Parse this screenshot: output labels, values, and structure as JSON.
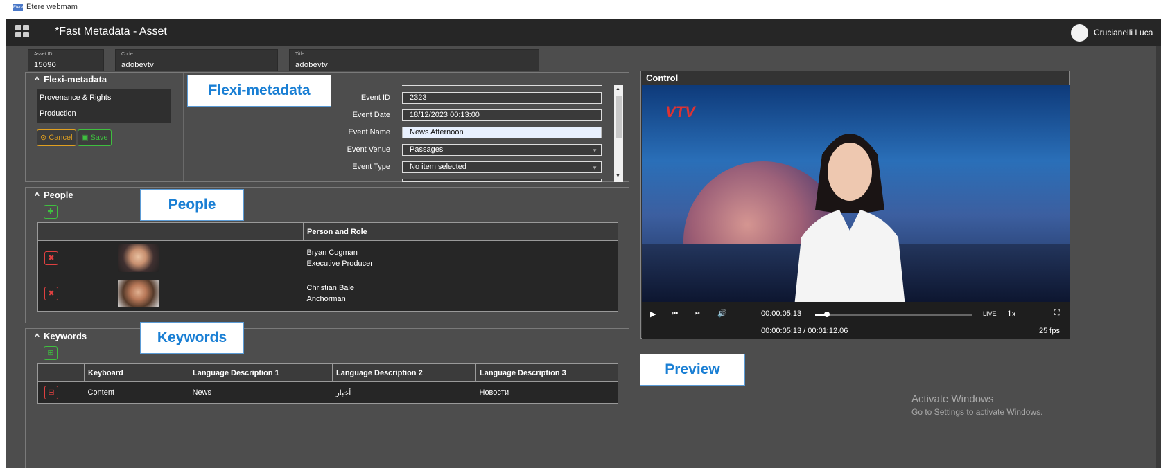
{
  "browser": {
    "title": "Etere webmam",
    "icon": "etere-logo-icon"
  },
  "header": {
    "title": "*Fast Metadata - Asset",
    "user": "Crucianelli Luca"
  },
  "asset_fields": [
    {
      "label": "Asset ID",
      "value": "15090"
    },
    {
      "label": "Code",
      "value": "adobevtv"
    },
    {
      "label": "Title",
      "value": "adobevtv"
    }
  ],
  "flexi": {
    "title": "Flexi-metadata",
    "callout": "Flexi-metadata",
    "list": [
      "Provenance & Rights",
      "Production"
    ],
    "cancel": "Cancel",
    "save": "Save",
    "form": [
      {
        "label": "Event ID",
        "value": "2323"
      },
      {
        "label": "Event Date",
        "value": "18/12/2023 00:13:00"
      },
      {
        "label": "Event Name",
        "value": "News Afternoon"
      },
      {
        "label": "Event Venue",
        "value": "Passages"
      },
      {
        "label": "Event Type",
        "value": "No item selected"
      }
    ]
  },
  "people": {
    "title": "People",
    "callout": "People",
    "column": "Person and Role",
    "rows": [
      {
        "name": "Bryan Cogman",
        "role": "Executive Producer"
      },
      {
        "name": "Christian Bale",
        "role": "Anchorman"
      }
    ]
  },
  "keywords": {
    "title": "Keywords",
    "callout": "Keywords",
    "columns": [
      "Keyboard",
      "Language Description 1",
      "Language Description 2",
      "Language Description 3"
    ],
    "rows": [
      {
        "keyword": "Content",
        "lang1": "News",
        "lang2": "أخبار",
        "lang3": "Новости"
      }
    ]
  },
  "control": {
    "title": "Control",
    "channel_logo": "VTV",
    "time_current": "00:00:05:13",
    "time_total": "00:00:05:13 / 00:01:12.06",
    "live": "LIVE",
    "speed": "1x",
    "fps": "25 fps",
    "progress_percent": 7
  },
  "preview_callout": "Preview",
  "watermark": {
    "line1": "Activate Windows",
    "line2": "Go to Settings to activate Windows."
  }
}
